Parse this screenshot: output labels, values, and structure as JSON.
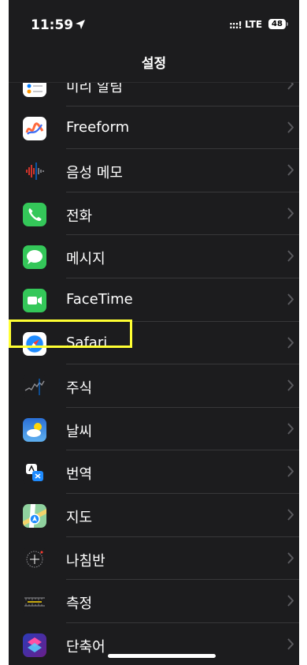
{
  "status_bar": {
    "time": "11:59",
    "signal": ":::!",
    "network": "LTE",
    "battery": "48"
  },
  "nav": {
    "title": "설정"
  },
  "settings_items": [
    {
      "label": "미리 알림",
      "icon": "reminders-icon",
      "color": "#ffffff"
    },
    {
      "label": "Freeform",
      "icon": "freeform-icon",
      "color": "#ffffff"
    },
    {
      "label": "음성 메모",
      "icon": "voice-memos-icon",
      "color": "#1c1c1e"
    },
    {
      "label": "전화",
      "icon": "phone-icon",
      "color": "#34c759"
    },
    {
      "label": "메시지",
      "icon": "messages-icon",
      "color": "#34c759"
    },
    {
      "label": "FaceTime",
      "icon": "facetime-icon",
      "color": "#34c759"
    },
    {
      "label": "Safari",
      "icon": "safari-icon",
      "color": "#ffffff"
    },
    {
      "label": "주식",
      "icon": "stocks-icon",
      "color": "#1c1c1e"
    },
    {
      "label": "날씨",
      "icon": "weather-icon",
      "color": "#2f7bd8"
    },
    {
      "label": "번역",
      "icon": "translate-icon",
      "color": "#1c1c1e"
    },
    {
      "label": "지도",
      "icon": "maps-icon",
      "color": "#5ac866"
    },
    {
      "label": "나침반",
      "icon": "compass-icon",
      "color": "#1c1c1e"
    },
    {
      "label": "측정",
      "icon": "measure-icon",
      "color": "#1c1c1e"
    },
    {
      "label": "단축어",
      "icon": "shortcuts-icon",
      "color": "#3a1e7a"
    }
  ],
  "highlight": {
    "target": "Safari",
    "color": "#ffff33"
  }
}
